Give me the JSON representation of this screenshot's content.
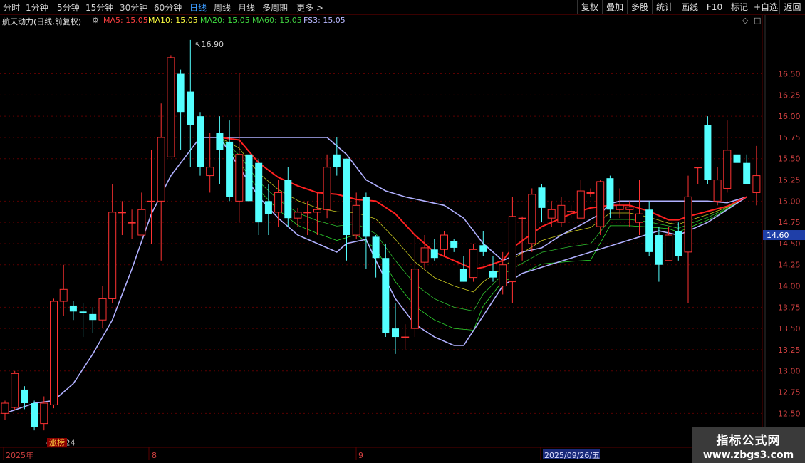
{
  "toolbar": {
    "periods": [
      "分时",
      "1分钟",
      "5分钟",
      "15分钟",
      "30分钟",
      "60分钟",
      "日线",
      "周线",
      "月线",
      "多周期",
      "更多 >"
    ],
    "active_period": "日线",
    "right_buttons": [
      "复权",
      "叠加",
      "多股",
      "统计",
      "画线",
      "F10",
      "标记",
      "+自选",
      "返回"
    ]
  },
  "legend": {
    "stock": "航天动力(日线,前复权)",
    "ma5": "MA5: 15.05",
    "ma10": "MA10: 15.05",
    "ma20": "MA20: 15.05",
    "ma60": "MA60: 15.05",
    "fs3": "FS3: 15.05"
  },
  "colors": {
    "up": "#ff3232",
    "down": "#54ffff",
    "ma5": "#ff2020",
    "ma10": "#ffff40",
    "ma20": "#30e030",
    "ma60": "#30c030",
    "fs3": "#b0b0ff",
    "grid": "#5a0000",
    "price_tag_bg": "#1f3fa8"
  },
  "annotations": {
    "high": "16.90",
    "low": "12.24",
    "badge": "涨榜"
  },
  "price_tag": "14.60",
  "xaxis": {
    "year": "2025年",
    "m8": "8",
    "m9": "9",
    "cursor_date": "2025/09/26/五"
  },
  "watermark": {
    "line1": "指标公式网",
    "line2": "www.zbgs3.com"
  },
  "chart_data": {
    "type": "candlestick",
    "yticks": [
      12.5,
      12.75,
      13.0,
      13.25,
      13.5,
      13.75,
      14.0,
      14.25,
      14.5,
      14.75,
      15.0,
      15.25,
      15.5,
      15.75,
      16.0,
      16.25,
      16.5
    ],
    "ylim": [
      12.1,
      17.05
    ],
    "candles": [
      [
        12.5,
        12.62,
        12.42,
        12.65
      ],
      [
        12.57,
        12.97,
        12.54,
        13.0
      ],
      [
        12.78,
        12.62,
        12.55,
        12.82
      ],
      [
        12.62,
        12.34,
        12.3,
        12.65
      ],
      [
        12.38,
        12.62,
        12.3,
        12.7
      ],
      [
        12.6,
        13.82,
        12.56,
        13.85
      ],
      [
        13.82,
        13.96,
        13.65,
        14.25
      ],
      [
        13.77,
        13.7,
        13.6,
        13.82
      ],
      [
        13.7,
        13.68,
        13.4,
        13.8
      ],
      [
        13.67,
        13.6,
        13.45,
        13.75
      ],
      [
        13.6,
        13.85,
        13.5,
        14.0
      ],
      [
        13.85,
        14.87,
        13.8,
        15.2
      ],
      [
        14.87,
        14.87,
        14.6,
        15.0
      ],
      [
        14.75,
        14.75,
        14.55,
        14.9
      ],
      [
        14.6,
        14.9,
        14.6,
        15.1
      ],
      [
        15.0,
        15.0,
        14.5,
        15.6
      ],
      [
        15.0,
        15.75,
        14.3,
        16.15
      ],
      [
        15.52,
        16.69,
        15.52,
        16.72
      ],
      [
        16.5,
        16.05,
        15.6,
        16.55
      ],
      [
        16.29,
        15.9,
        15.4,
        16.9
      ],
      [
        16.0,
        15.4,
        15.3,
        16.05
      ],
      [
        15.3,
        15.4,
        15.1,
        15.8
      ],
      [
        15.8,
        15.6,
        15.2,
        16.0
      ],
      [
        15.7,
        15.05,
        15.0,
        15.95
      ],
      [
        15.0,
        15.55,
        14.75,
        16.5
      ],
      [
        15.55,
        15.0,
        14.6,
        15.95
      ],
      [
        15.45,
        14.75,
        14.6,
        15.5
      ],
      [
        15.0,
        14.85,
        14.6,
        15.2
      ],
      [
        14.87,
        15.1,
        14.7,
        15.25
      ],
      [
        15.25,
        14.8,
        14.7,
        15.4
      ],
      [
        14.8,
        14.87,
        14.7,
        14.92
      ],
      [
        14.87,
        14.87,
        14.6,
        15.0
      ],
      [
        14.87,
        14.9,
        14.6,
        15.1
      ],
      [
        14.9,
        15.4,
        14.8,
        15.55
      ],
      [
        15.55,
        15.4,
        15.3,
        15.75
      ],
      [
        15.5,
        14.6,
        14.3,
        15.5
      ],
      [
        14.6,
        14.95,
        14.55,
        15.1
      ],
      [
        15.05,
        14.58,
        14.2,
        15.1
      ],
      [
        14.58,
        14.33,
        14.1,
        14.6
      ],
      [
        14.33,
        13.45,
        13.4,
        14.5
      ],
      [
        13.5,
        13.4,
        13.2,
        13.8
      ],
      [
        13.4,
        13.4,
        13.25,
        13.55
      ],
      [
        13.5,
        14.2,
        13.4,
        14.6
      ],
      [
        14.28,
        14.45,
        14.2,
        14.6
      ],
      [
        14.43,
        14.33,
        14.3,
        14.55
      ],
      [
        14.43,
        14.6,
        14.35,
        14.65
      ],
      [
        14.53,
        14.45,
        14.4,
        14.55
      ],
      [
        14.2,
        14.05,
        14.05,
        14.35
      ],
      [
        14.1,
        14.43,
        14.05,
        14.5
      ],
      [
        14.48,
        14.4,
        14.35,
        14.65
      ],
      [
        14.18,
        14.1,
        14.05,
        14.35
      ],
      [
        14.0,
        14.25,
        13.9,
        14.4
      ],
      [
        14.05,
        14.82,
        13.8,
        15.05
      ],
      [
        14.8,
        14.8,
        14.3,
        14.82
      ],
      [
        14.5,
        15.08,
        14.4,
        15.15
      ],
      [
        15.16,
        14.92,
        14.75,
        15.2
      ],
      [
        14.8,
        14.9,
        14.7,
        15.0
      ],
      [
        14.75,
        14.95,
        14.7,
        15.05
      ],
      [
        14.88,
        14.88,
        14.8,
        14.95
      ],
      [
        14.8,
        15.12,
        14.8,
        15.25
      ],
      [
        15.1,
        15.1,
        15.05,
        15.15
      ],
      [
        14.7,
        15.23,
        14.6,
        15.25
      ],
      [
        15.27,
        14.9,
        14.8,
        15.3
      ],
      [
        14.9,
        14.95,
        14.8,
        15.15
      ],
      [
        14.9,
        14.93,
        14.7,
        15.0
      ],
      [
        14.75,
        14.85,
        14.6,
        15.25
      ],
      [
        14.9,
        14.4,
        14.35,
        15.0
      ],
      [
        14.6,
        14.25,
        14.05,
        14.7
      ],
      [
        14.3,
        14.6,
        14.3,
        14.7
      ],
      [
        14.65,
        14.35,
        14.3,
        14.75
      ],
      [
        14.4,
        15.05,
        13.8,
        15.3
      ],
      [
        15.4,
        15.4,
        15.2,
        15.4
      ],
      [
        15.9,
        15.25,
        15.2,
        16.0
      ],
      [
        15.0,
        15.25,
        14.95,
        15.4
      ],
      [
        15.15,
        15.6,
        15.1,
        15.95
      ],
      [
        15.55,
        15.45,
        15.4,
        15.7
      ],
      [
        15.45,
        15.2,
        15.2,
        15.55
      ],
      [
        15.1,
        15.3,
        14.95,
        15.65
      ]
    ],
    "ma5": [
      [
        22,
        15.75
      ],
      [
        24,
        15.72
      ],
      [
        26,
        15.45
      ],
      [
        28,
        15.28
      ],
      [
        30,
        15.18
      ],
      [
        32,
        15.1
      ],
      [
        34,
        15.08
      ],
      [
        36,
        15.02
      ],
      [
        38,
        15.0
      ],
      [
        40,
        14.85
      ],
      [
        42,
        14.6
      ],
      [
        44,
        14.4
      ],
      [
        46,
        14.3
      ],
      [
        48,
        14.2
      ],
      [
        49,
        14.22
      ],
      [
        51,
        14.3
      ],
      [
        52,
        14.45
      ],
      [
        55,
        14.7
      ],
      [
        58,
        14.85
      ],
      [
        60,
        14.92
      ],
      [
        62,
        14.95
      ],
      [
        64,
        14.95
      ],
      [
        66,
        14.88
      ],
      [
        68,
        14.78
      ],
      [
        69,
        14.78
      ],
      [
        70,
        14.82
      ],
      [
        72,
        14.88
      ],
      [
        74,
        14.94
      ],
      [
        76,
        15.05
      ]
    ],
    "fs3": [
      [
        0,
        12.5
      ],
      [
        3,
        12.62
      ],
      [
        5,
        12.65
      ],
      [
        7,
        12.85
      ],
      [
        9,
        13.2
      ],
      [
        11,
        13.6
      ],
      [
        13,
        14.2
      ],
      [
        15,
        14.85
      ],
      [
        17,
        15.3
      ],
      [
        19,
        15.6
      ],
      [
        20,
        15.75
      ],
      [
        21,
        15.75
      ],
      [
        22,
        15.75
      ],
      [
        33,
        15.75
      ],
      [
        34,
        15.65
      ],
      [
        35,
        15.55
      ],
      [
        37,
        15.25
      ],
      [
        39,
        15.12
      ],
      [
        41,
        15.05
      ],
      [
        43,
        15.0
      ],
      [
        45,
        14.95
      ],
      [
        47,
        14.8
      ],
      [
        49,
        14.5
      ],
      [
        51,
        14.3
      ],
      [
        53,
        14.4
      ],
      [
        55,
        14.45
      ],
      [
        57,
        14.6
      ],
      [
        59,
        14.72
      ],
      [
        61,
        14.85
      ],
      [
        62,
        14.97
      ],
      [
        63,
        15.0
      ],
      [
        64,
        15.0
      ],
      [
        69,
        15.0
      ],
      [
        72,
        15.0
      ],
      [
        74,
        14.98
      ],
      [
        76,
        15.05
      ]
    ],
    "lower": [
      [
        22,
        15.75
      ],
      [
        24,
        15.4
      ],
      [
        26,
        15.05
      ],
      [
        28,
        14.8
      ],
      [
        30,
        14.6
      ],
      [
        32,
        14.5
      ],
      [
        34,
        14.4
      ],
      [
        35,
        14.5
      ],
      [
        37,
        14.55
      ],
      [
        38,
        14.3
      ],
      [
        40,
        13.85
      ],
      [
        42,
        13.55
      ],
      [
        44,
        13.4
      ],
      [
        46,
        13.3
      ],
      [
        47,
        13.3
      ],
      [
        49,
        13.65
      ],
      [
        51,
        14.0
      ],
      [
        53,
        14.15
      ],
      [
        67,
        14.65
      ],
      [
        69,
        14.6
      ],
      [
        70,
        14.65
      ],
      [
        72,
        14.75
      ],
      [
        74,
        14.9
      ],
      [
        76,
        15.05
      ]
    ]
  }
}
